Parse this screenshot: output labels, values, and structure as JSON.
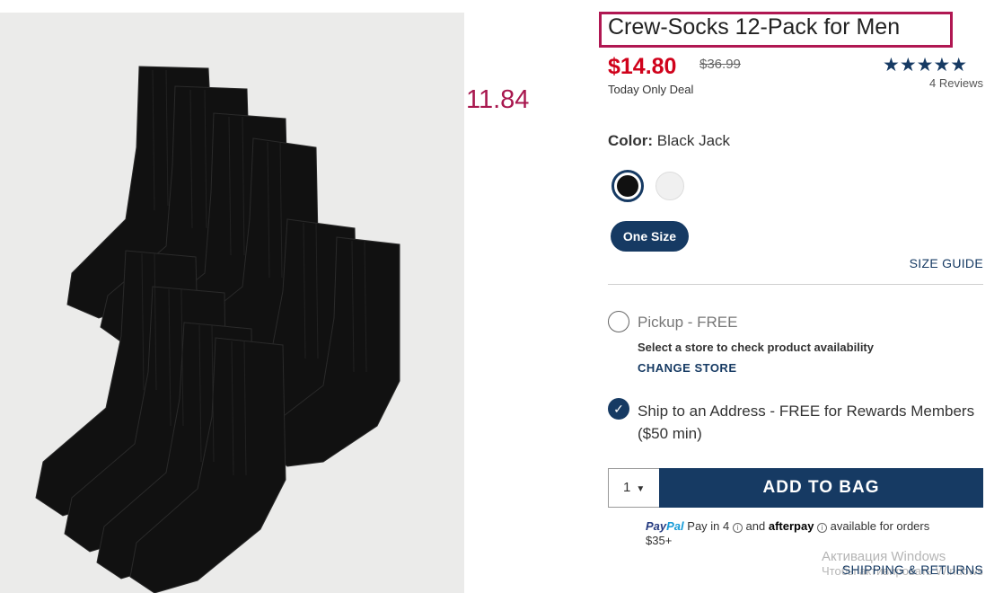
{
  "product": {
    "title": "Crew-Socks 12-Pack for Men",
    "price": "$14.80",
    "original_price": "$36.99",
    "deal_label": "Today Only Deal",
    "rating_stars": "★★★★★",
    "rating_value": 4.5,
    "reviews": "4 Reviews",
    "image_icon": "socks-image"
  },
  "annotation": "11.84",
  "color": {
    "label": "Color:",
    "value": "Black Jack",
    "swatches": [
      {
        "name": "Black Jack",
        "hex": "#111111",
        "selected": true
      },
      {
        "name": "White",
        "hex": "#f0f0f0",
        "selected": false
      }
    ]
  },
  "size": {
    "selected": "One Size",
    "guide_label": "SIZE GUIDE"
  },
  "fulfillment": {
    "pickup_label": "Pickup - FREE",
    "pickup_note": "Select a store to check product availability",
    "change_store": "CHANGE STORE",
    "ship_label": "Ship to an Address - FREE for Rewards Members ($50 min)",
    "ship_selected": true
  },
  "cart": {
    "quantity": "1",
    "add_label": "ADD TO BAG"
  },
  "payment": {
    "paypal_a": "Pay",
    "paypal_b": "Pal",
    "pay_in": "Pay in 4",
    "and": "and",
    "afterpay": "afterpay",
    "available": "available for orders $35+"
  },
  "shipping_link": "SHIPPING & RETURNS",
  "watermark": {
    "line1": "Активация Windows",
    "line2": "Чтобы активировать Windows"
  },
  "colors": {
    "navy": "#163a63",
    "sale_red": "#d0021b",
    "highlight": "#b01752"
  }
}
